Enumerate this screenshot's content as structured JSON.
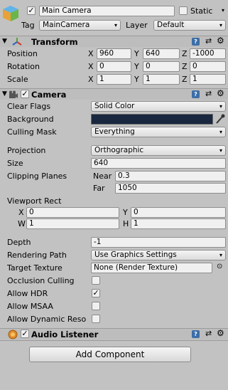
{
  "gameobject": {
    "active": true,
    "name": "Main Camera",
    "static_label": "Static",
    "tag_label": "Tag",
    "tag_value": "MainCamera",
    "layer_label": "Layer",
    "layer_value": "Default"
  },
  "transform": {
    "title": "Transform",
    "position_label": "Position",
    "rotation_label": "Rotation",
    "scale_label": "Scale",
    "position": {
      "x": "960",
      "y": "640",
      "z": "-1000"
    },
    "rotation": {
      "x": "0",
      "y": "0",
      "z": "0"
    },
    "scale": {
      "x": "1",
      "y": "1",
      "z": "1"
    }
  },
  "axes": {
    "x": "X",
    "y": "Y",
    "z": "Z",
    "w": "W",
    "h": "H"
  },
  "camera": {
    "title": "Camera",
    "enabled": true,
    "clear_flags_label": "Clear Flags",
    "clear_flags_value": "Solid Color",
    "background_label": "Background",
    "background_color": "#19273f",
    "culling_mask_label": "Culling Mask",
    "culling_mask_value": "Everything",
    "projection_label": "Projection",
    "projection_value": "Orthographic",
    "size_label": "Size",
    "size_value": "640",
    "clipping_label": "Clipping Planes",
    "near_label": "Near",
    "near_value": "0.3",
    "far_label": "Far",
    "far_value": "1050",
    "viewport_label": "Viewport Rect",
    "viewport": {
      "x": "0",
      "y": "0",
      "w": "1",
      "h": "1"
    },
    "depth_label": "Depth",
    "depth_value": "-1",
    "rendering_path_label": "Rendering Path",
    "rendering_path_value": "Use Graphics Settings",
    "target_texture_label": "Target Texture",
    "target_texture_value": "None (Render Texture)",
    "occlusion_label": "Occlusion Culling",
    "hdr_label": "Allow HDR",
    "msaa_label": "Allow MSAA",
    "dynres_label": "Allow Dynamic Reso",
    "hdr_checked": true
  },
  "audio_listener": {
    "title": "Audio Listener",
    "enabled": true
  },
  "add_component_label": "Add Component",
  "icons": {
    "gameobject": "cube-icon",
    "transform": "axes-icon",
    "camera": "camera-icon",
    "audio": "audio-listener-icon",
    "help": "help-book-icon",
    "preset": "preset-icon",
    "gear": "gear-icon",
    "picker": "eyedropper-icon",
    "target": "object-picker-icon"
  },
  "colors": {
    "panel_bg": "#c2c2c2",
    "header_bg": "#bdbdbd",
    "help_blue": "#3c6ea8"
  },
  "checkmark": "✓",
  "dropdown_arrow": "▾"
}
